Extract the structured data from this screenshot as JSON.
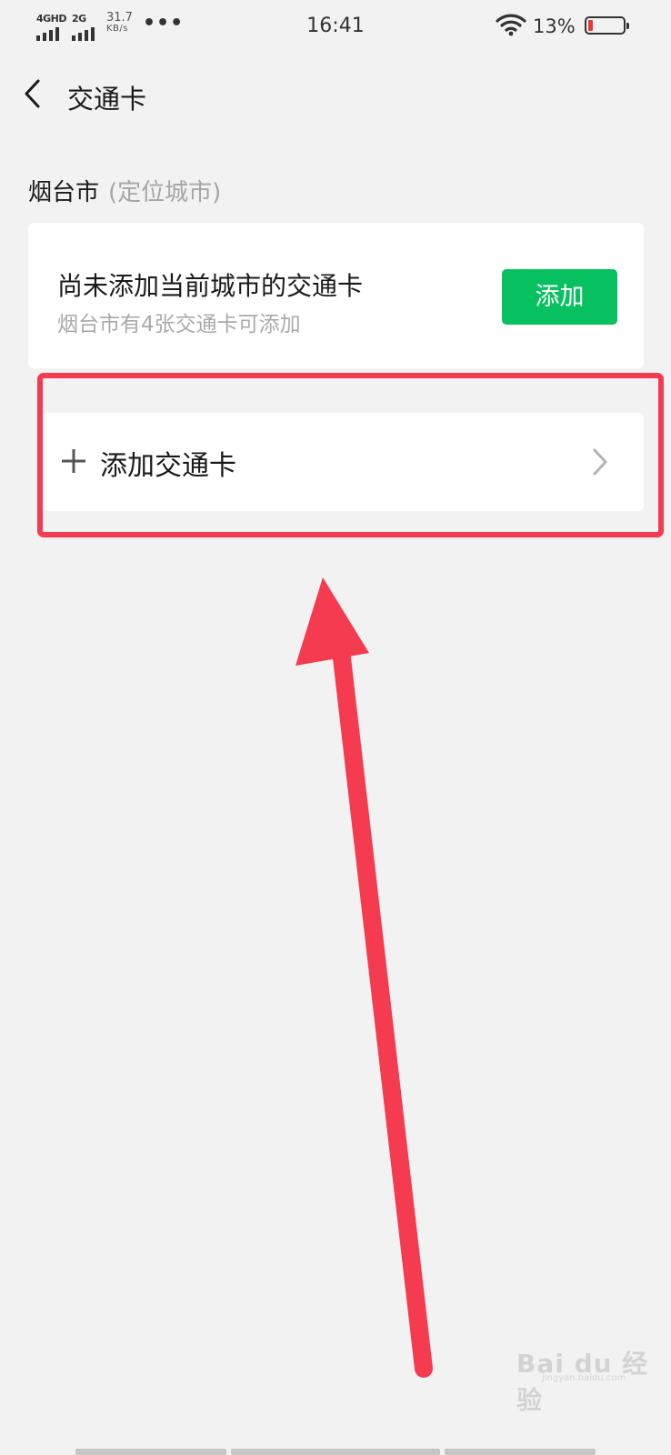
{
  "status_bar": {
    "sim1_label": "4GHD",
    "sim2_label": "2G",
    "net_speed": "31.7",
    "net_speed_unit": "KB/s",
    "overflow": "•••",
    "time": "16:41",
    "battery_percent": "13%",
    "battery_level": 0.13,
    "icons": [
      "signal-icon",
      "wifi-icon",
      "battery-icon"
    ]
  },
  "nav": {
    "back_icon": "chevron-left-icon",
    "title": "交通卡"
  },
  "location": {
    "city": "烟台市",
    "tag": "(定位城市)"
  },
  "current_city_card": {
    "title": "尚未添加当前城市的交通卡",
    "subtitle": "烟台市有4张交通卡可添加",
    "add_button": "添加"
  },
  "add_card_row": {
    "icon": "plus-icon",
    "label": "添加交通卡",
    "chevron": "chevron-right-icon"
  },
  "annotation": {
    "highlight_color": "#f53b4f"
  },
  "watermark": {
    "text": "Bai du 经验",
    "url": "jingyan.baidu.com"
  },
  "colors": {
    "accent_green": "#07c160",
    "background": "#f2f2f2",
    "secondary_text": "#aaaaaa"
  }
}
